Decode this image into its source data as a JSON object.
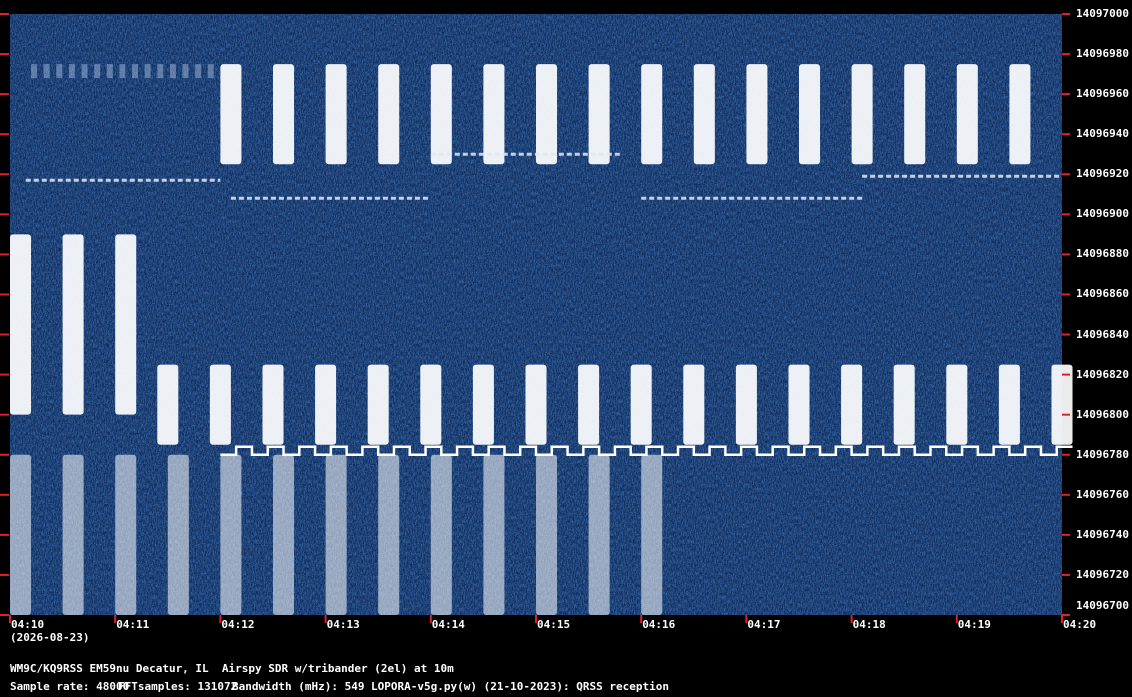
{
  "chart_data": {
    "type": "heatmap",
    "title": "",
    "xlabel": "",
    "ylabel": "",
    "x_ticks": [
      "04:10",
      "04:11",
      "04:12",
      "04:13",
      "04:14",
      "04:15",
      "04:16",
      "04:17",
      "04:18",
      "04:19",
      "04:20"
    ],
    "y_ticks": [
      "14097000",
      "14096980",
      "14096960",
      "14096940",
      "14096920",
      "14096900",
      "14096880",
      "14096860",
      "14096840",
      "14096820",
      "14096800",
      "14096780",
      "14096760",
      "14096740",
      "14096720",
      "14096700"
    ],
    "ylim": [
      14096700,
      14097000
    ],
    "xlim_minutes": [
      0,
      10
    ],
    "colors": {
      "background": "#0a2a5e",
      "signal": "#ffffff",
      "tick_marker": "#e0202a"
    },
    "signal_bands": [
      {
        "f_low": 14096955,
        "f_high": 14096975,
        "t_start": 0.2,
        "t_end": 2.0,
        "pattern": "dashed-top"
      },
      {
        "f_low": 14096925,
        "f_high": 14096975,
        "t_start": 2.0,
        "t_end": 10.0,
        "pattern": "bursts"
      },
      {
        "f_low": 14096800,
        "f_high": 14096890,
        "t_start": 0.0,
        "t_end": 1.2,
        "pattern": "bursts"
      },
      {
        "f_low": 14096785,
        "f_high": 14096825,
        "t_start": 1.4,
        "t_end": 10.0,
        "pattern": "bursts"
      },
      {
        "f_low": 14096700,
        "f_high": 14096780,
        "t_start": 0.0,
        "t_end": 6.5,
        "pattern": "bursts-faded"
      }
    ],
    "traces": [
      {
        "freq": 14096917,
        "t_start": 0.15,
        "t_end": 2.0
      },
      {
        "freq": 14096908,
        "t_start": 2.1,
        "t_end": 4.0
      },
      {
        "freq": 14096930,
        "t_start": 4.0,
        "t_end": 5.8
      },
      {
        "freq": 14096908,
        "t_start": 6.0,
        "t_end": 8.1
      },
      {
        "freq": 14096919,
        "t_start": 8.1,
        "t_end": 10.0
      }
    ],
    "fsk_trace": {
      "freq_low": 14096780,
      "freq_high": 14096784,
      "t_start": 2.0,
      "t_end": 10.0
    }
  },
  "date_label": "(2026-08-23)",
  "station_line": "WM9C/KQ9RSS EM59nu Decatur, IL  Airspy SDR w/tribander (2el) at 10m",
  "params": {
    "sample_rate": "Sample rate: 48000",
    "fft_samples": "FFTsamples: 131072",
    "bandwidth": "Bandwidth (mHz): 549",
    "software": "LOPORA-v5g.py(w) (21-10-2023): QRSS reception"
  }
}
